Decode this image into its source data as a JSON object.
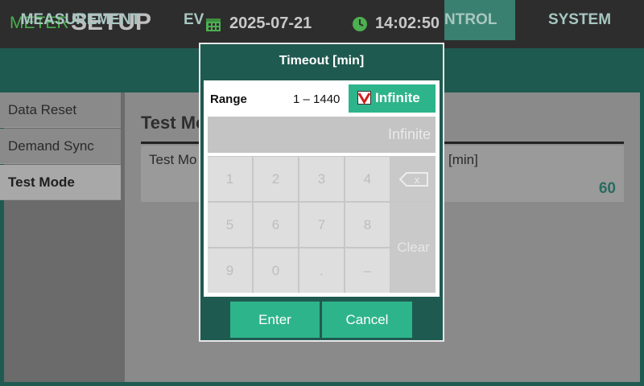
{
  "header": {
    "brand_meter": "METER",
    "brand_setup": "SETUP",
    "date": "2025-07-21",
    "time": "14:02:50",
    "date_icon": "calendar-icon",
    "time_icon": "clock-icon"
  },
  "tabs": [
    {
      "label": "MEASUREMENT"
    },
    {
      "label": "EV"
    },
    {
      "label": "NTROL"
    },
    {
      "label": "SYSTEM"
    }
  ],
  "sidebar": {
    "items": [
      {
        "label": "Data Reset"
      },
      {
        "label": "Demand Sync"
      },
      {
        "label": "Test Mode"
      }
    ]
  },
  "content": {
    "title": "Test Mo",
    "field_label": "Test Mo",
    "field_unit": "[min]",
    "field_value": "60"
  },
  "dialog": {
    "title": "Timeout [min]",
    "range_label": "Range",
    "range_value": "1 – 1440",
    "infinite_label": "Infinite",
    "infinite_checked": true,
    "display_value": "Infinite",
    "keys": [
      "1",
      "2",
      "3",
      "4",
      "5",
      "6",
      "7",
      "8",
      "9",
      "0",
      ".",
      "–"
    ],
    "clear_label": "Clear",
    "backspace_label": "x",
    "enter_label": "Enter",
    "cancel_label": "Cancel"
  },
  "colors": {
    "accent": "#2eb48a",
    "dialog_bg": "#1f5a50",
    "brand_green": "#4caf50"
  }
}
